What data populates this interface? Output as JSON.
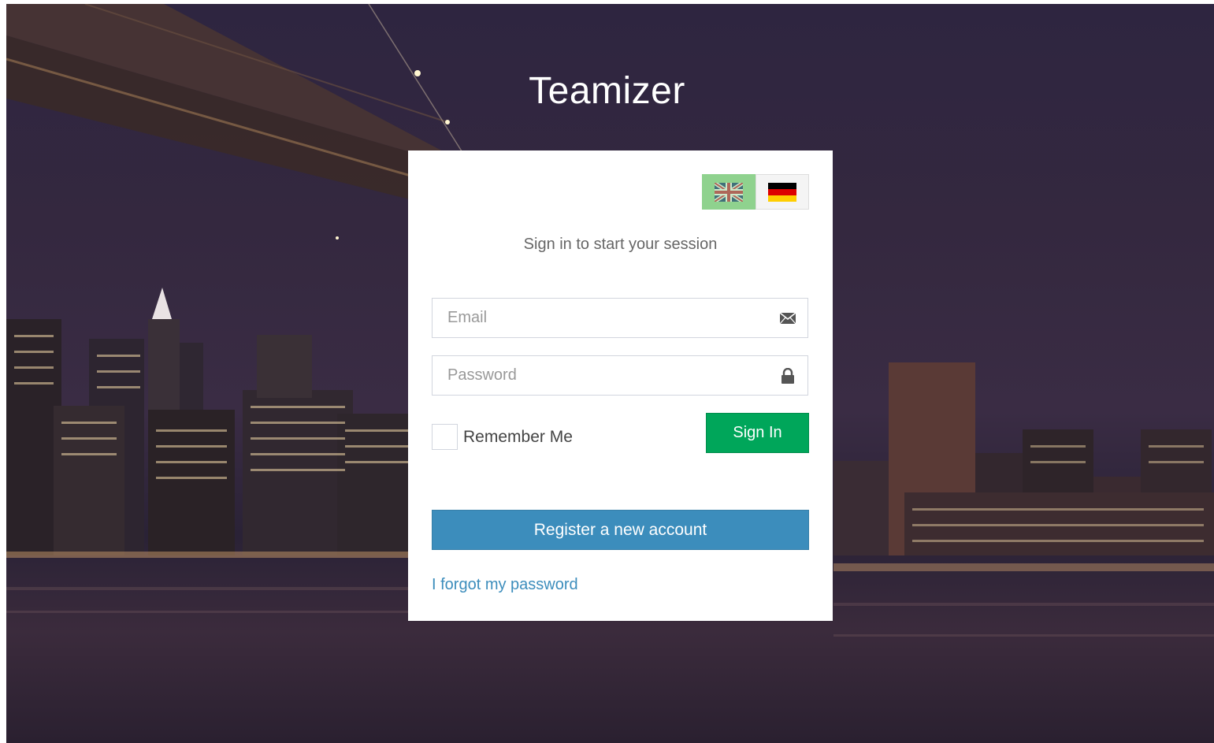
{
  "app": {
    "title": "Teamizer"
  },
  "login": {
    "message": "Sign in to start your session",
    "email_placeholder": "Email",
    "email_value": "",
    "password_placeholder": "Password",
    "password_value": "",
    "remember_label": "Remember Me",
    "remember_checked": false,
    "signin_label": "Sign In",
    "register_label": "Register a new account",
    "forgot_label": "I forgot my password"
  },
  "languages": [
    {
      "code": "en",
      "icon": "uk-flag-icon",
      "active": true
    },
    {
      "code": "de",
      "icon": "german-flag-icon",
      "active": false
    }
  ],
  "icons": {
    "email": "envelope-icon",
    "password": "lock-icon"
  },
  "colors": {
    "signin": "#00a65a",
    "register": "#3c8dbc",
    "link": "#3c8dbc",
    "active_language": "#8fd28e"
  }
}
